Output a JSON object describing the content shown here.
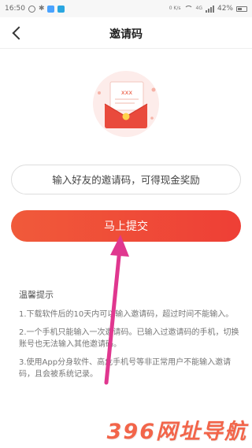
{
  "status_bar": {
    "time": "16:50",
    "network_label": "4G",
    "speed_label": "0 K/s",
    "battery_label": "42%"
  },
  "header": {
    "title": "邀请码"
  },
  "invite": {
    "placeholder": "输入好友的邀请码，可得现金奖励",
    "value": ""
  },
  "submit": {
    "label": "马上提交"
  },
  "tips": {
    "title": "温馨提示",
    "items": [
      "1.下载软件后的10天内可以输入邀请码，超过时间不能输入。",
      "2.一个手机只能输入一次邀请码。已输入过邀请码的手机，切换账号也无法输入其他邀请码。",
      "3.使用App分身软件、高危手机号等非正常用户不能输入邀请码，且会被系统记录。"
    ]
  },
  "illustration": {
    "envelope_text": "xxx"
  },
  "watermark": {
    "text": "396网址导航"
  },
  "colors": {
    "accent": "#ee4a36",
    "arrow": "#e0378f"
  }
}
